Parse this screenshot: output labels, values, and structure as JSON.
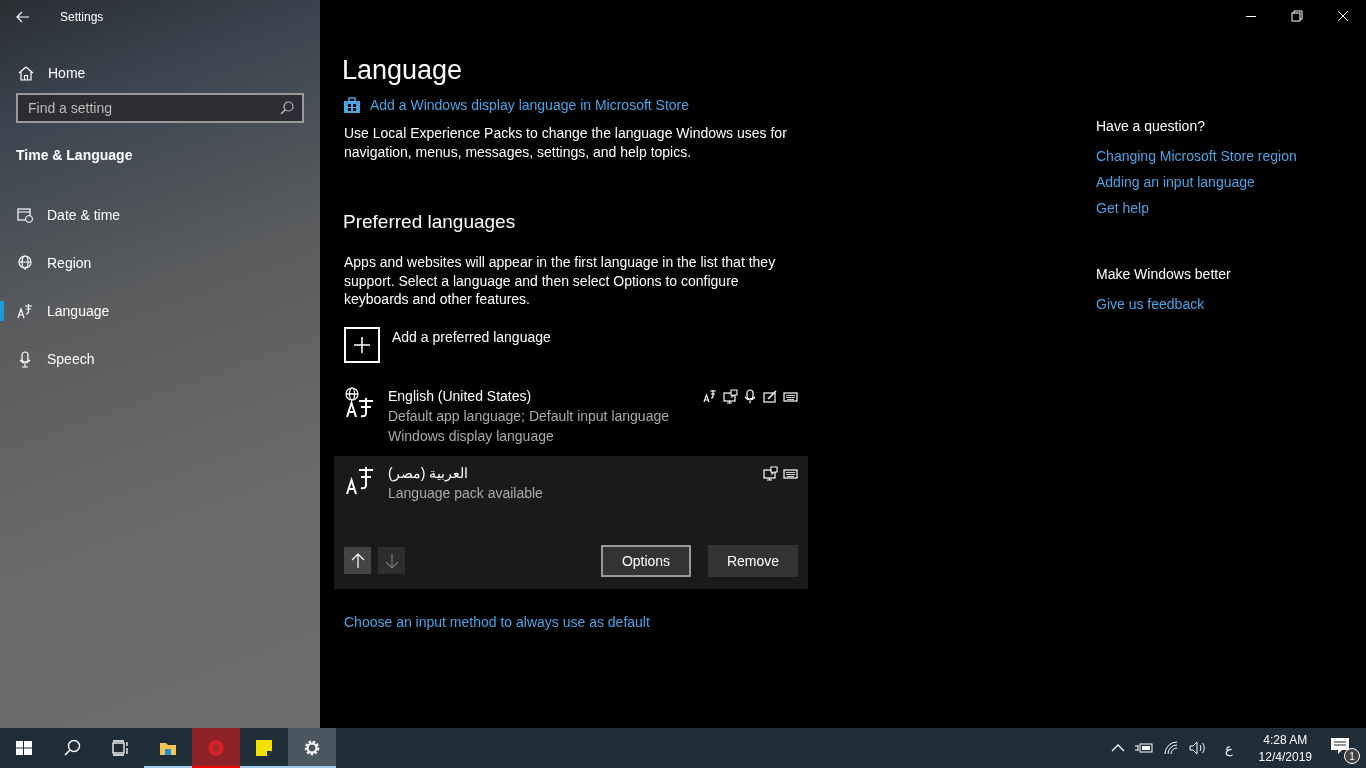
{
  "window": {
    "title": "Settings"
  },
  "sidebar": {
    "home": "Home",
    "search": {
      "placeholder": "Find a setting"
    },
    "section": "Time & Language",
    "items": [
      {
        "label": "Date & time",
        "kind": "calendar",
        "selected": false
      },
      {
        "label": "Region",
        "kind": "globe",
        "selected": false
      },
      {
        "label": "Language",
        "kind": "language",
        "selected": true
      },
      {
        "label": "Speech",
        "kind": "microphone",
        "selected": false
      }
    ]
  },
  "main": {
    "title": "Language",
    "store_link": "Add a Windows display language in Microsoft Store",
    "store_text": "Use Local Experience Packs to change the language Windows uses for navigation, menus, messages, settings, and help topics.",
    "preferred_heading": "Preferred languages",
    "preferred_text": "Apps and websites will appear in the first language in the list that they support. Select a language and then select Options to configure keyboards and other features.",
    "add_language": "Add a preferred language",
    "languages": [
      {
        "name": "English (United States)",
        "kind": "display",
        "details": [
          "Default app language; Default input language",
          "Windows display language"
        ],
        "features": [
          {
            "kind": "display-language"
          },
          {
            "kind": "text-to-speech"
          },
          {
            "kind": "speech"
          },
          {
            "kind": "handwriting"
          },
          {
            "kind": "keyboard"
          }
        ],
        "selected": false
      },
      {
        "name": "العربية (مصر)",
        "kind": "installed",
        "details": [
          "Language pack available"
        ],
        "features": [
          {
            "kind": "text-to-speech"
          },
          {
            "kind": "keyboard"
          }
        ],
        "selected": true
      }
    ],
    "move_up": {
      "disabled": false
    },
    "move_down": {
      "disabled": true
    },
    "options": "Options",
    "remove": "Remove",
    "input_method_link": "Choose an input method to always use as default"
  },
  "aside": {
    "question": "Have a question?",
    "question_links": [
      "Changing Microsoft Store region",
      "Adding an input language",
      "Get help"
    ],
    "better": "Make Windows better",
    "better_links": [
      "Give us feedback"
    ]
  },
  "taskbar": {
    "apps": [
      {
        "kind": "start",
        "running": false,
        "selected": false
      },
      {
        "kind": "search",
        "running": false,
        "selected": false
      },
      {
        "kind": "task-view",
        "running": false,
        "selected": false
      },
      {
        "kind": "file-explorer",
        "running": true,
        "selected": false
      },
      {
        "kind": "opera",
        "running": true,
        "selected": false
      },
      {
        "kind": "sticky-notes",
        "running": true,
        "selected": false
      },
      {
        "kind": "settings",
        "running": true,
        "selected": true
      }
    ],
    "input_indicator": "ع",
    "time": "4:28 AM",
    "date": "12/4/2019",
    "notifications": "1"
  }
}
